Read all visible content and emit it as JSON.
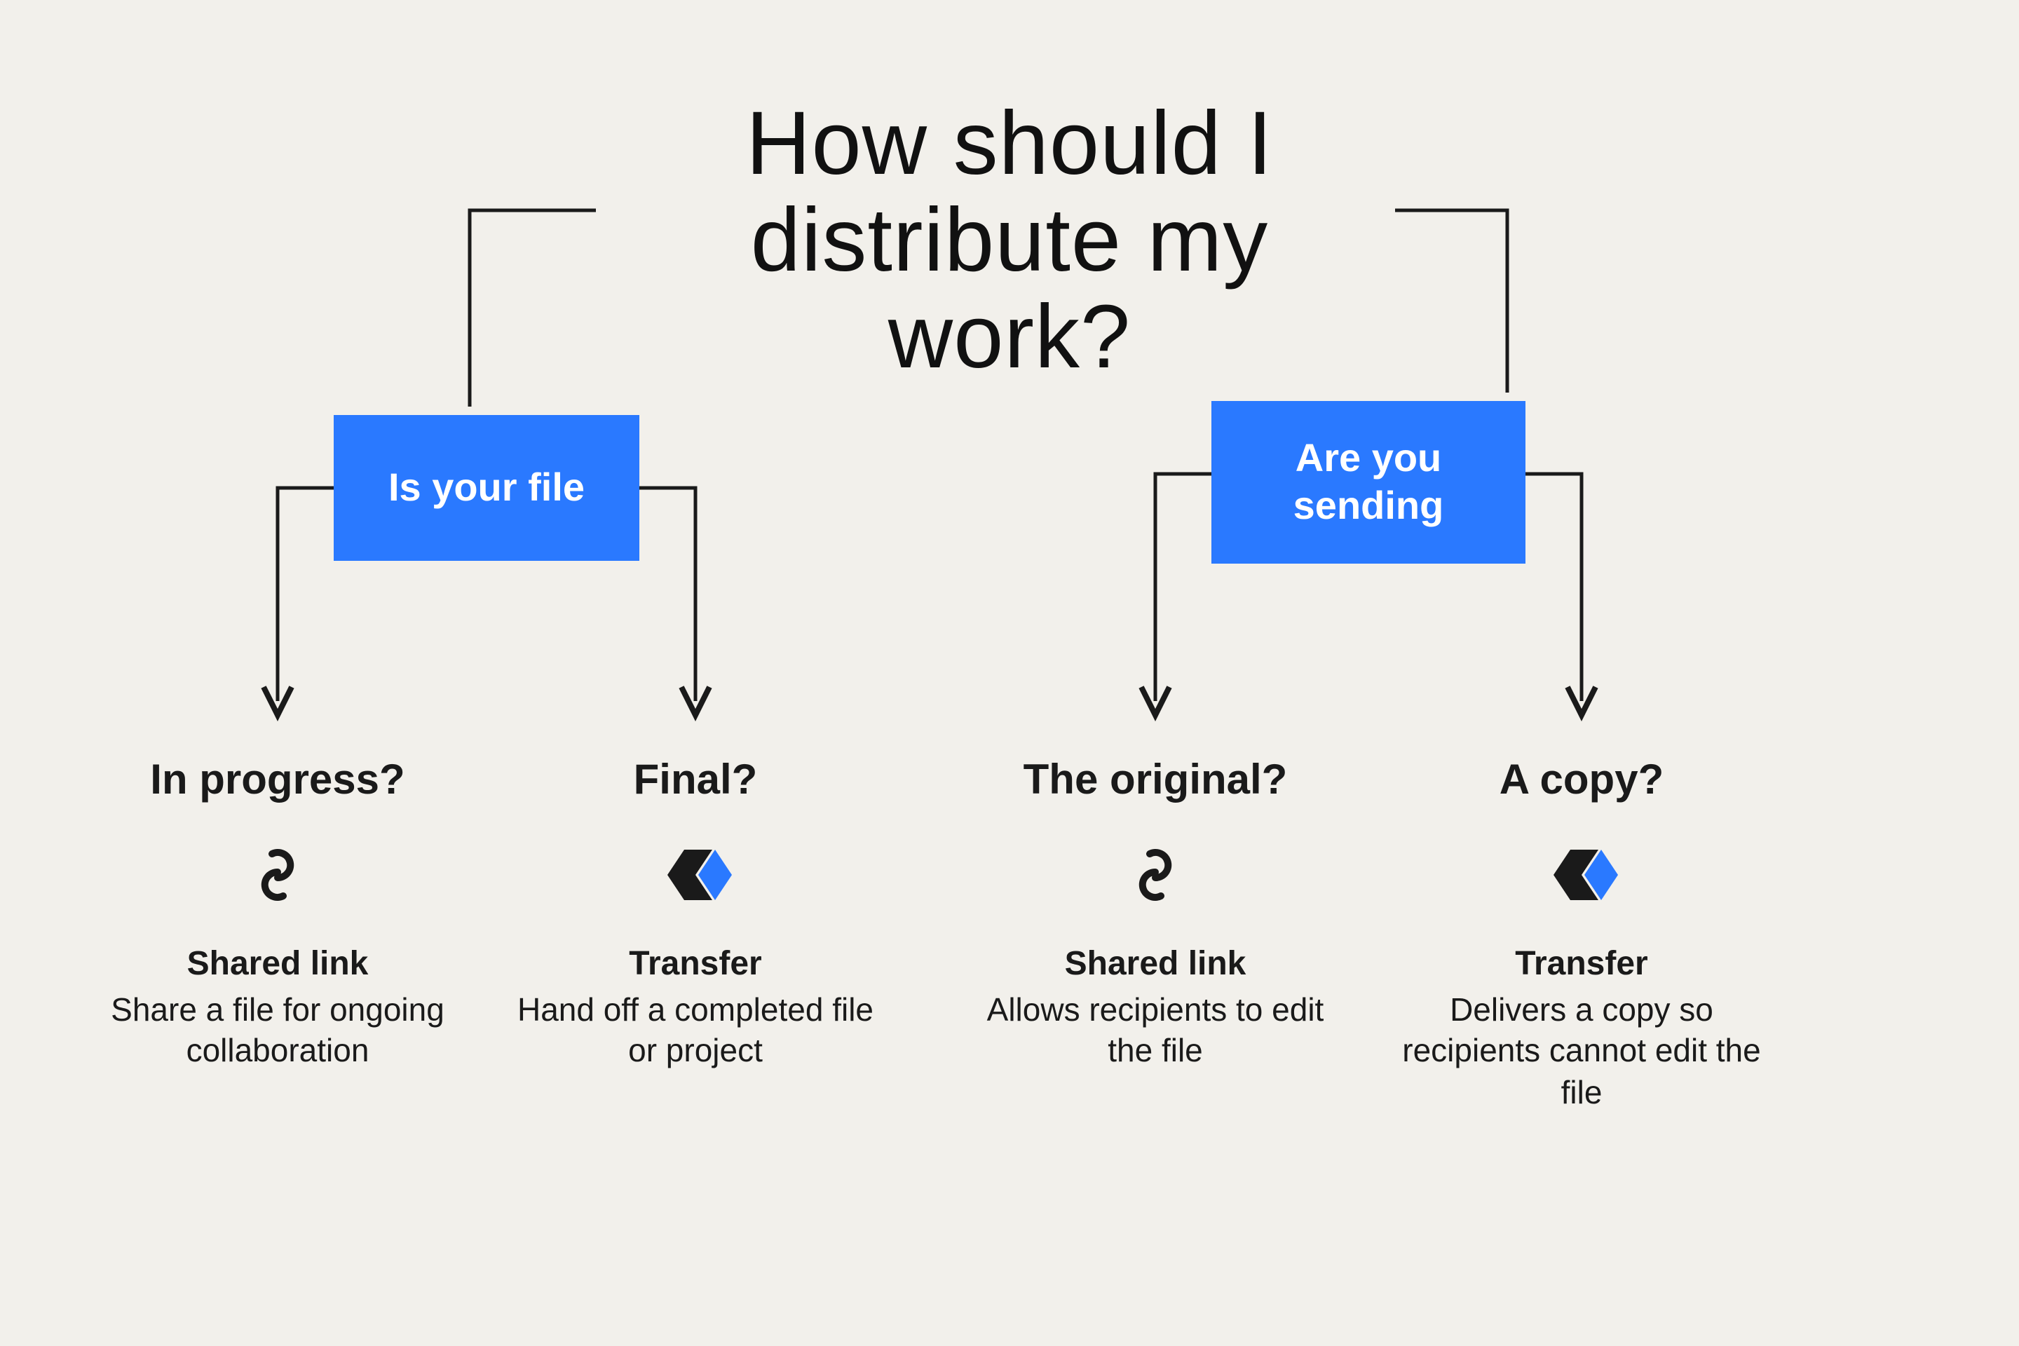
{
  "title": "How should I\ndistribute my\nwork?",
  "colors": {
    "accent": "#2a79ff",
    "ink": "#1a1a1a",
    "bg": "#f2f0eb"
  },
  "branches": [
    {
      "key": "file-status",
      "box_label": "Is your file",
      "options": [
        {
          "key": "in-progress",
          "question": "In progress?",
          "icon": "link-icon",
          "result_name": "Shared link",
          "result_desc": "Share a file for ongoing collaboration"
        },
        {
          "key": "final",
          "question": "Final?",
          "icon": "transfer-icon",
          "result_name": "Transfer",
          "result_desc": "Hand off a completed file or project"
        }
      ]
    },
    {
      "key": "sending-what",
      "box_label": "Are you\nsending",
      "options": [
        {
          "key": "original",
          "question": "The original?",
          "icon": "link-icon",
          "result_name": "Shared link",
          "result_desc": "Allows recipients to edit the file"
        },
        {
          "key": "copy",
          "question": "A copy?",
          "icon": "transfer-icon",
          "result_name": "Transfer",
          "result_desc": "Delivers a copy so recipients cannot edit the file"
        }
      ]
    }
  ]
}
